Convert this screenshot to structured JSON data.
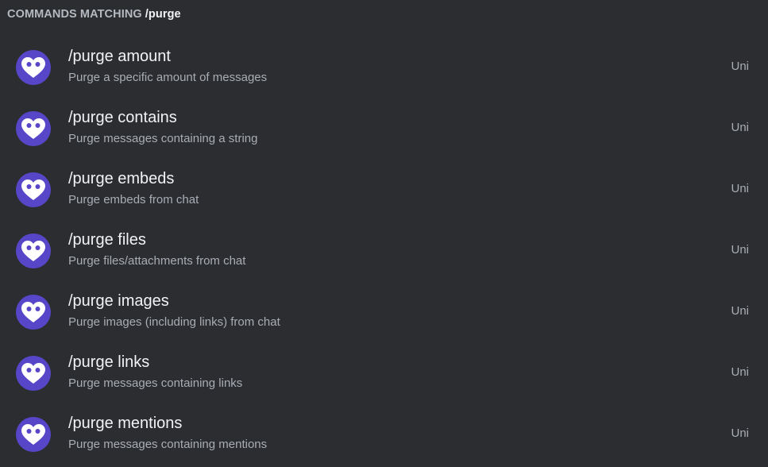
{
  "header": {
    "label": "COMMANDS MATCHING",
    "query": "/purge"
  },
  "colors": {
    "background": "#2b2d31",
    "avatar": "#5846c8",
    "command_text": "#f2f3f5",
    "muted_text": "#a9adb4"
  },
  "commands": [
    {
      "name": "/purge amount",
      "description": "Purge a specific amount of messages",
      "source": "Uni",
      "icon": "heart-icon"
    },
    {
      "name": "/purge contains",
      "description": "Purge messages containing a string",
      "source": "Uni",
      "icon": "heart-icon"
    },
    {
      "name": "/purge embeds",
      "description": "Purge embeds from chat",
      "source": "Uni",
      "icon": "heart-icon"
    },
    {
      "name": "/purge files",
      "description": "Purge files/attachments from chat",
      "source": "Uni",
      "icon": "heart-icon"
    },
    {
      "name": "/purge images",
      "description": "Purge images (including links) from chat",
      "source": "Uni",
      "icon": "heart-icon"
    },
    {
      "name": "/purge links",
      "description": "Purge messages containing links",
      "source": "Uni",
      "icon": "heart-icon"
    },
    {
      "name": "/purge mentions",
      "description": "Purge messages containing mentions",
      "source": "Uni",
      "icon": "heart-icon"
    }
  ]
}
